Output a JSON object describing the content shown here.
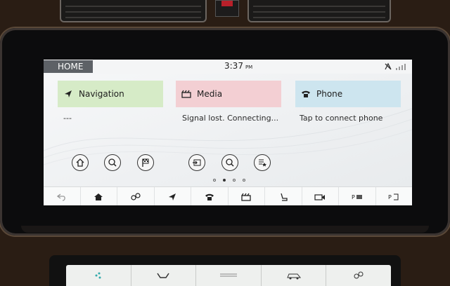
{
  "status_bar": {
    "home_label": "HOME",
    "time": "3:37",
    "ampm": "PM"
  },
  "cards": {
    "navigation": {
      "title": "Navigation",
      "subtitle": "---",
      "icon": "navigation-arrow-icon",
      "color": "#d6ebc7"
    },
    "media": {
      "title": "Media",
      "subtitle": "Signal lost. Connecting...",
      "icon": "clapperboard-icon",
      "color": "#f3cfd3"
    },
    "phone": {
      "title": "Phone",
      "subtitle": "Tap to connect phone",
      "icon": "phone-icon",
      "color": "#cde5ef"
    }
  },
  "page_indicator": {
    "count": 4,
    "active": 1
  },
  "toolbar": [
    "back-icon",
    "home-icon",
    "connect-icon",
    "navigation-icon",
    "phone-icon",
    "media-icon",
    "seat-icon",
    "camera-icon",
    "profile-icon",
    "parking-icon"
  ],
  "climate_strip": [
    "fan-icon",
    "seat-heat-icon",
    "defrost-icon",
    "vehicle-icon",
    "settings-icon"
  ]
}
